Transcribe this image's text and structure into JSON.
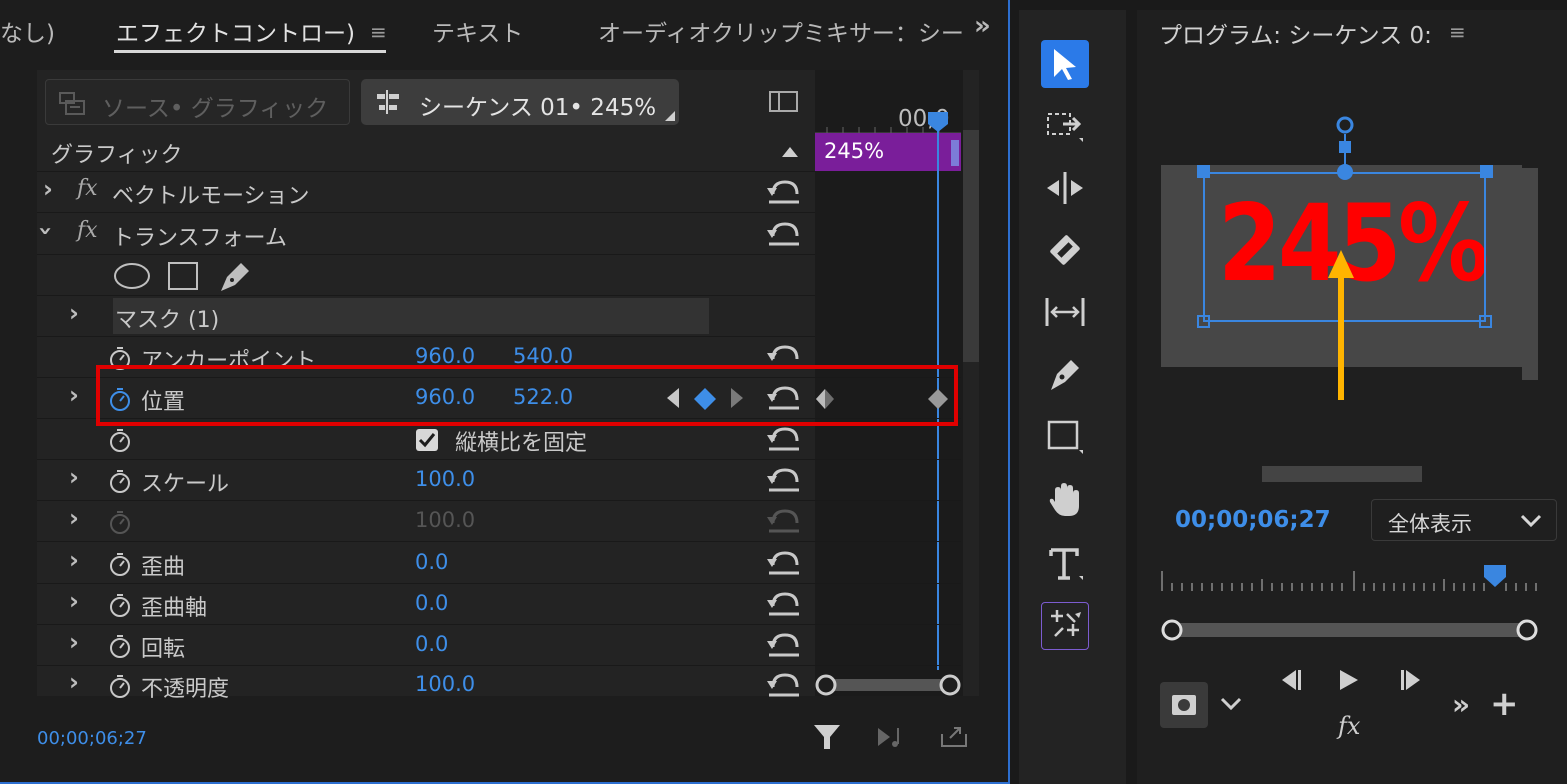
{
  "effect_controls": {
    "tabs": [
      {
        "label": "なし)",
        "active": false
      },
      {
        "label": "エフェクトコントロー)",
        "active": true
      },
      {
        "label": "テキスト",
        "active": false
      },
      {
        "label": "オーディオクリップミキサー：シー",
        "active": false
      }
    ],
    "tab_overflow": "»",
    "menu_glyph": "≡",
    "source_button": "ソース• グラフィック",
    "sequence_button": "シーケンス 01• 245%",
    "ruler_time": "00;0",
    "clip_label": "245%",
    "section_header": "グラフィック",
    "rows": {
      "vector_motion": "ベクトルモーション",
      "transform": "トランスフォーム",
      "mask": "マスク (1)",
      "anchor": {
        "label": "アンカーポイント",
        "x": "960.0",
        "y": "540.0"
      },
      "position": {
        "label": "位置",
        "x": "960.0",
        "y": "522.0"
      },
      "uniform_scale": "縦横比を固定",
      "scale": {
        "label": "スケール",
        "value": "100.0"
      },
      "scale_width": {
        "value": "100.0"
      },
      "skew": {
        "label": "歪曲",
        "value": "0.0"
      },
      "skew_axis": {
        "label": "歪曲軸",
        "value": "0.0"
      },
      "rotation": {
        "label": "回転",
        "value": "0.0"
      },
      "opacity": {
        "label": "不透明度",
        "value": "100.0"
      }
    },
    "fx_glyph": "fx",
    "current_time": "00;00;06;27"
  },
  "program_monitor": {
    "title": "プログラム: シーケンス 0:",
    "menu_glyph": "≡",
    "canvas_text": "245%",
    "current_time": "00;00;06;27",
    "fit_option": "全体表示",
    "fx_glyph": "fx",
    "overflow": "»",
    "add": "+"
  },
  "colors": {
    "accent": "#3e8ee8",
    "highlight": "#e00000",
    "clip": "#7a1e9a",
    "text_red": "#ff0000",
    "arrow": "#ffb400"
  }
}
